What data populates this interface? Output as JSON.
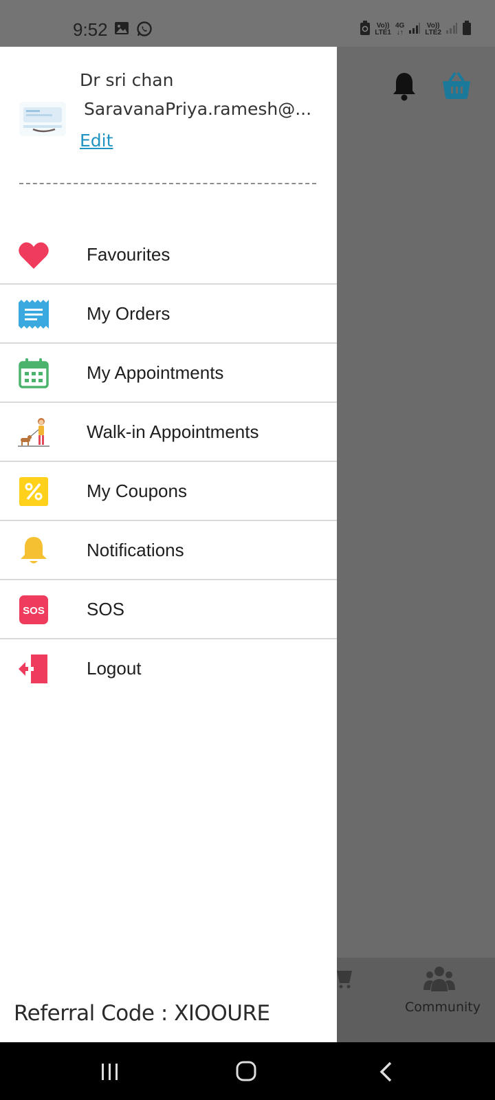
{
  "status_bar": {
    "time": "9:52",
    "sim1_label_top": "Vo))",
    "sim1_label_bottom": "LTE1",
    "net_label_top": "4G",
    "sim2_label_top": "Vo))",
    "sim2_label_bottom": "LTE2",
    "icons": [
      "gallery-icon",
      "whatsapp-icon",
      "battery-saver-icon",
      "signal-icon",
      "battery-icon"
    ]
  },
  "background_app": {
    "top_icons": [
      "bell-icon",
      "basket-icon"
    ],
    "basket_color": "#1b8fb5",
    "bottom_nav": [
      {
        "label": "op",
        "icon": "cart-icon"
      },
      {
        "label": "Community",
        "icon": "community-icon"
      }
    ]
  },
  "drawer": {
    "profile": {
      "name": "Dr sri chan",
      "email": "SaravanaPriya.ramesh@...",
      "edit_label": "Edit"
    },
    "menu": [
      {
        "label": "Favourites",
        "icon": "heart-icon",
        "color": "#ef3b5c"
      },
      {
        "label": "My Orders",
        "icon": "receipt-icon",
        "color": "#3aa9df"
      },
      {
        "label": "My Appointments",
        "icon": "calendar-icon",
        "color": "#4bb36b"
      },
      {
        "label": "Walk-in Appointments",
        "icon": "dog-walk-icon",
        "color": "#e6a23c"
      },
      {
        "label": "My Coupons",
        "icon": "coupon-icon",
        "color": "#ffd11a"
      },
      {
        "label": "Notifications",
        "icon": "bell-icon",
        "color": "#f5c032"
      },
      {
        "label": "SOS",
        "icon": "sos-icon",
        "color": "#ef3b5c",
        "badge_text": "SOS"
      },
      {
        "label": "Logout",
        "icon": "logout-icon",
        "color": "#ef3b5c"
      }
    ],
    "referral_text": "Referral Code : XIOOURE"
  },
  "system_nav": [
    "recents-button",
    "home-button",
    "back-button"
  ]
}
